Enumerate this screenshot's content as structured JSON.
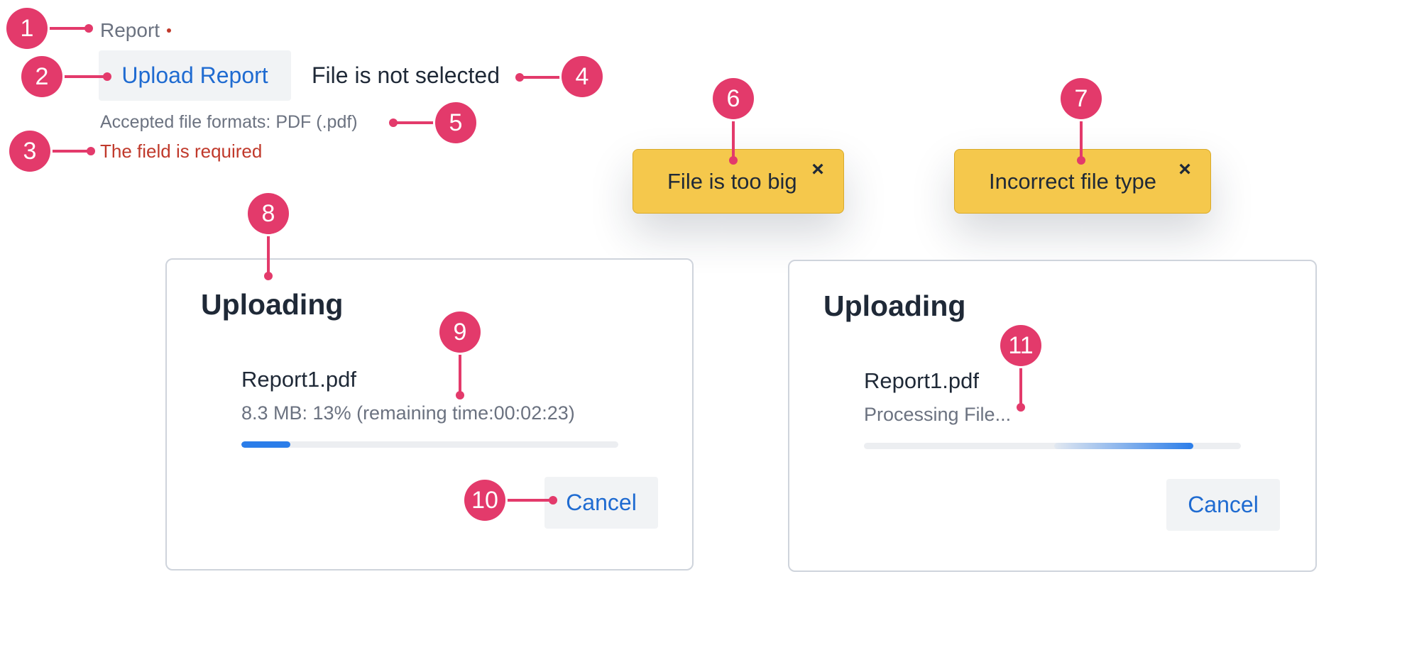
{
  "form": {
    "label": "Report",
    "upload_button": "Upload Report",
    "file_status": "File is not selected",
    "accepted_formats": "Accepted file formats: PDF (.pdf)",
    "required_error": "The field is required"
  },
  "toasts": [
    {
      "text": "File is too big",
      "close": "×"
    },
    {
      "text": "Incorrect file type",
      "close": "×"
    }
  ],
  "dialogs": [
    {
      "title": "Uploading",
      "file_name": "Report1.pdf",
      "info": "8.3 MB: 13% (remaining time:00:02:23)",
      "progress_percent": 13,
      "cancel": "Cancel"
    },
    {
      "title": "Uploading",
      "file_name": "Report1.pdf",
      "info": "Processing File...",
      "progress": "indeterminate",
      "cancel": "Cancel"
    }
  ],
  "markers": [
    "1",
    "2",
    "3",
    "4",
    "5",
    "6",
    "7",
    "8",
    "9",
    "10",
    "11"
  ],
  "colors": {
    "marker": "#e33a6b",
    "link_blue": "#1f6bd1",
    "error_red": "#c0392b",
    "toast_yellow": "#f5c84c",
    "progress_blue": "#2b7de9"
  }
}
